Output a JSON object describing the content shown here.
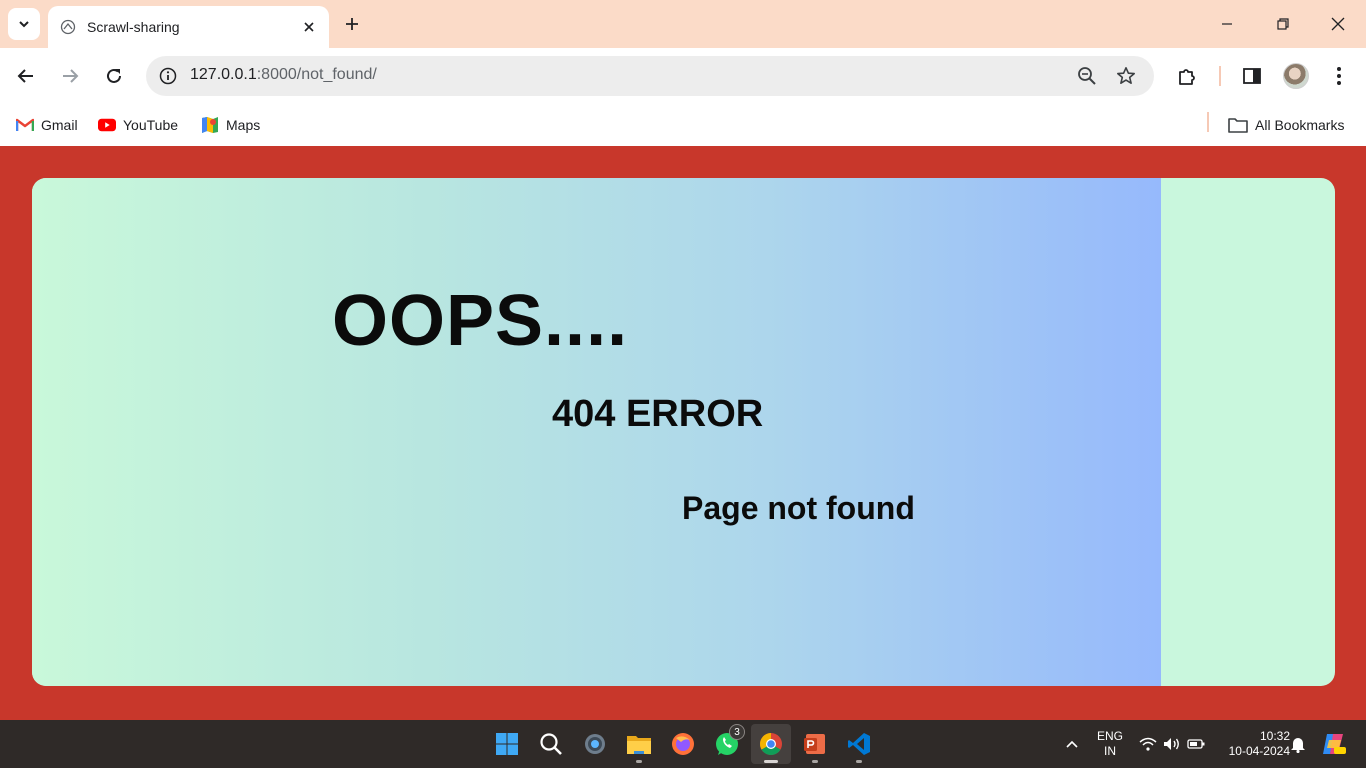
{
  "browser": {
    "tab_title": "Scrawl-sharing",
    "url_host": "127.0.0.1",
    "url_rest": ":8000/not_found/",
    "bookmarks": [
      {
        "label": "Gmail",
        "icon": "gmail-icon"
      },
      {
        "label": "YouTube",
        "icon": "youtube-icon"
      },
      {
        "label": "Maps",
        "icon": "maps-icon"
      }
    ],
    "all_bookmarks_label": "All Bookmarks"
  },
  "page": {
    "headline": "OOPS....",
    "error_code": "404 ERROR",
    "message": "Page not found",
    "colors": {
      "background": "#c8372b",
      "card_base": "#c9f7dd",
      "gradient_start": "#c9f8da",
      "gradient_end": "#96b9fc",
      "text": "#0b0b0b"
    }
  },
  "taskbar": {
    "apps": [
      "start-icon",
      "search-icon",
      "settings-icon",
      "file-explorer-icon",
      "firefox-icon",
      "whatsapp-icon",
      "chrome-icon",
      "powerpoint-icon",
      "vscode-icon"
    ],
    "whatsapp_badge": "3",
    "lang_top": "ENG",
    "lang_bottom": "IN",
    "time": "10:32",
    "date": "10-04-2024"
  }
}
